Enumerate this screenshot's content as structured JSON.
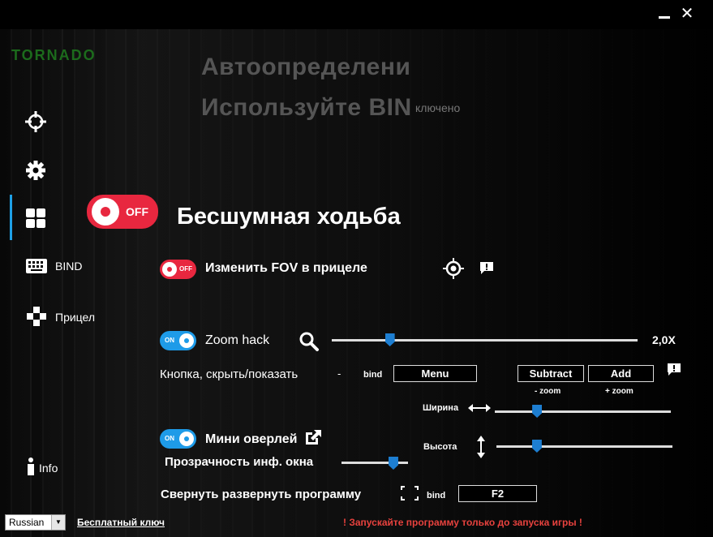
{
  "window": {
    "minimize_icon": "minimize-icon",
    "close_icon": "close-icon"
  },
  "logo_text": "TORNADO",
  "sidebar": {
    "items": [
      {
        "name": "crosshair-nav",
        "icon": "crosshair-icon",
        "label": ""
      },
      {
        "name": "settings-nav",
        "icon": "gear-icon",
        "label": ""
      },
      {
        "name": "grid-nav",
        "icon": "grid-icon",
        "label": ""
      },
      {
        "name": "bind-nav",
        "icon": "keyboard-icon",
        "label": "BIND"
      },
      {
        "name": "aim-nav",
        "icon": "gamepad-icon",
        "label": "Прицел"
      },
      {
        "name": "info-nav",
        "icon": "info-icon",
        "label": "Info"
      }
    ],
    "active_index": 2
  },
  "banner": {
    "line1": "Автоопределени",
    "line2": "Используйте BIN",
    "line2_suffix": "ключено"
  },
  "silent_walk": {
    "label": "Бесшумная ходьба",
    "state": "OFF"
  },
  "fov": {
    "label": "Изменить FOV в прицеле",
    "state": "OFF"
  },
  "zoom": {
    "label": "Zoom hack",
    "state": "ON",
    "value_text": "2,0X",
    "slider_fraction": 0.19,
    "key_label": "Кнопка, скрыть/показать",
    "dash": "-",
    "bind_label": "bind",
    "bind_value": "Menu",
    "subtract_label": "Subtract",
    "add_label": "Add",
    "minus_caption": "- zoom",
    "plus_caption": "+ zoom"
  },
  "overlay": {
    "label": "Мини оверлей",
    "state": "ON",
    "width_label": "Ширина",
    "width_fraction": 0.24,
    "height_label": "Высота",
    "height_fraction": 0.23,
    "transparency_label": "Прозрачность инф. окна",
    "transparency_fraction": 0.78
  },
  "minimize_app": {
    "label": "Свернуть развернуть программу",
    "bind_label": "bind",
    "bind_value": "F2"
  },
  "footer": {
    "language": "Russian",
    "free_key": "Бесплатный ключ",
    "warning": "! Запускайте программу только до запуска игры !"
  },
  "colors": {
    "off_red": "#e8273f",
    "on_blue": "#1e9be8",
    "slider_blue": "#1d7ed1",
    "warning_red": "#e8423e"
  }
}
